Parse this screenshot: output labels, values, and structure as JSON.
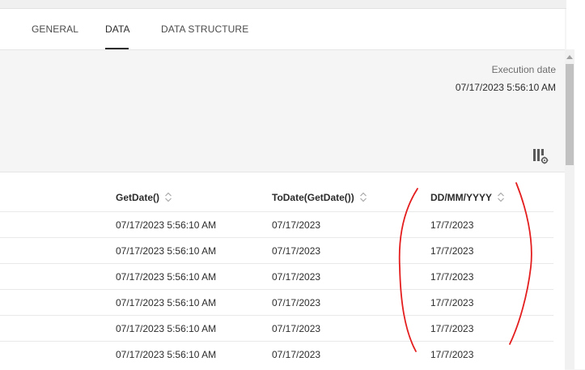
{
  "tabs": [
    {
      "label": "GENERAL",
      "active": false
    },
    {
      "label": "DATA",
      "active": true
    },
    {
      "label": "DATA STRUCTURE",
      "active": false
    }
  ],
  "execution": {
    "label": "Execution date",
    "value": "07/17/2023 5:56:10 AM"
  },
  "table": {
    "columns": [
      "GetDate()",
      "ToDate(GetDate())",
      "DD/MM/YYYY"
    ],
    "rows": [
      [
        "07/17/2023 5:56:10 AM",
        "07/17/2023",
        "17/7/2023"
      ],
      [
        "07/17/2023 5:56:10 AM",
        "07/17/2023",
        "17/7/2023"
      ],
      [
        "07/17/2023 5:56:10 AM",
        "07/17/2023",
        "17/7/2023"
      ],
      [
        "07/17/2023 5:56:10 AM",
        "07/17/2023",
        "17/7/2023"
      ],
      [
        "07/17/2023 5:56:10 AM",
        "07/17/2023",
        "17/7/2023"
      ],
      [
        "07/17/2023 5:56:10 AM",
        "07/17/2023",
        "17/7/2023"
      ]
    ]
  },
  "icons": {
    "column_settings": "column-settings-icon",
    "sort": "sort-icon"
  },
  "colors": {
    "annotation": "#e41e1e",
    "active_tab_underline": "#2c2c2c"
  }
}
